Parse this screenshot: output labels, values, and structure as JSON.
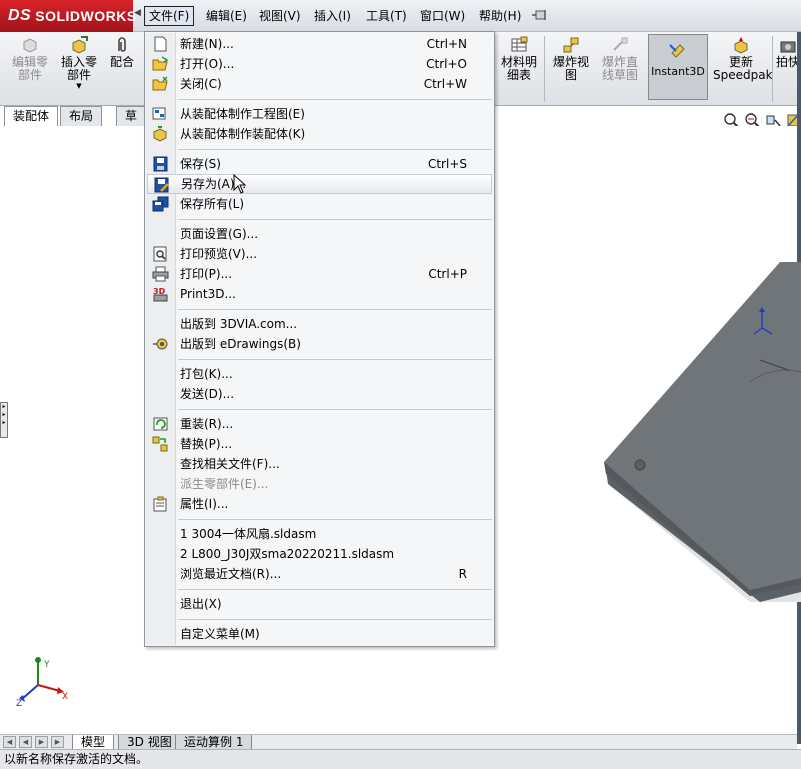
{
  "app": {
    "logo_text": "SOLIDWORKS",
    "logo_mark": "DS"
  },
  "menubar": {
    "items": [
      "文件(F)",
      "编辑(E)",
      "视图(V)",
      "插入(I)",
      "工具(T)",
      "窗口(W)",
      "帮助(H)"
    ],
    "active_index": 0
  },
  "toolbar": {
    "edit_component": "编辑零\n部件",
    "insert_component": "插入零\n部件",
    "mate": "配合",
    "bom": "材料明\n细表",
    "exploded_view": "爆炸视\n图",
    "explode_line_sketch": "爆炸直\n线草图",
    "instant3d": "Instant3D",
    "update_speedpak": "更新\nSpeedpak",
    "snapshot": "拍快"
  },
  "cm_tabs": [
    "装配体",
    "布局",
    "草"
  ],
  "file_menu": {
    "items": [
      {
        "label": "新建(N)...",
        "shortcut": "Ctrl+N",
        "icon": "new-document-icon"
      },
      {
        "label": "打开(O)...",
        "shortcut": "Ctrl+O",
        "icon": "open-folder-icon"
      },
      {
        "label": "关闭(C)",
        "shortcut": "Ctrl+W",
        "icon": "close-folder-icon"
      },
      {
        "label": "从装配体制作工程图(E)",
        "shortcut": "",
        "icon": "make-drawing-icon"
      },
      {
        "label": "从装配体制作装配体(K)",
        "shortcut": "",
        "icon": "make-assembly-icon"
      },
      {
        "label": "保存(S)",
        "shortcut": "Ctrl+S",
        "icon": "save-icon"
      },
      {
        "label": "另存为(A)...",
        "shortcut": "",
        "icon": "save-as-icon",
        "highlighted": true
      },
      {
        "label": "保存所有(L)",
        "shortcut": "",
        "icon": "save-all-icon"
      },
      {
        "label": "页面设置(G)...",
        "shortcut": "",
        "icon": ""
      },
      {
        "label": "打印预览(V)...",
        "shortcut": "",
        "icon": "print-preview-icon"
      },
      {
        "label": "打印(P)...",
        "shortcut": "Ctrl+P",
        "icon": "printer-icon"
      },
      {
        "label": "Print3D...",
        "shortcut": "",
        "icon": "print3d-icon"
      },
      {
        "label": "出版到 3DVIA.com...",
        "shortcut": "",
        "icon": ""
      },
      {
        "label": "出版到 eDrawings(B)",
        "shortcut": "",
        "icon": "edrawings-icon"
      },
      {
        "label": "打包(K)...",
        "shortcut": "",
        "icon": ""
      },
      {
        "label": "发送(D)...",
        "shortcut": "",
        "icon": ""
      },
      {
        "label": "重装(R)...",
        "shortcut": "",
        "icon": "reload-icon"
      },
      {
        "label": "替换(P)...",
        "shortcut": "",
        "icon": "replace-icon"
      },
      {
        "label": "查找相关文件(F)...",
        "shortcut": "",
        "icon": ""
      },
      {
        "label": "派生零部件(E)...",
        "shortcut": "",
        "icon": "",
        "disabled": true
      },
      {
        "label": "属性(I)...",
        "shortcut": "",
        "icon": "properties-icon"
      },
      {
        "label": "1 3004一体风扇.sldasm",
        "shortcut": "",
        "icon": ""
      },
      {
        "label": "2 L800_J30J双sma20220211.sldasm",
        "shortcut": "",
        "icon": ""
      },
      {
        "label": "浏览最近文档(R)...",
        "shortcut": "R",
        "icon": ""
      },
      {
        "label": "退出(X)",
        "shortcut": "",
        "icon": ""
      },
      {
        "label": "自定义菜单(M)",
        "shortcut": "",
        "icon": ""
      }
    ]
  },
  "bottom_tabs": [
    "模型",
    "3D 视图",
    "运动算例 1"
  ],
  "status": {
    "text": "以新名称保存激活的文档。"
  },
  "colors": {
    "logo_red": "#c4161c",
    "plate_gray": "#6e7377",
    "accent_blue": "#1f5fbf"
  }
}
